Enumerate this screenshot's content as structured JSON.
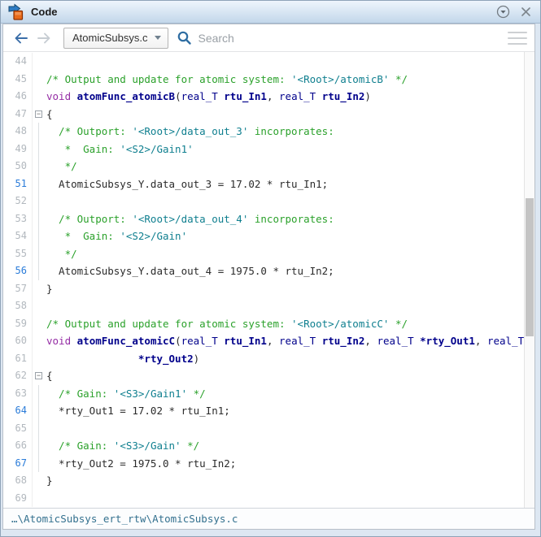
{
  "window": {
    "title": "Code"
  },
  "toolbar": {
    "back_label": "back",
    "forward_label": "forward",
    "file_selector": "AtomicSubsys.c",
    "search_placeholder": "Search"
  },
  "statusbar": {
    "path": "…\\AtomicSubsys_ert_rtw\\AtomicSubsys.c"
  },
  "colors": {
    "comment_green": "#2ba12b",
    "model_link_teal": "#0f7f8f",
    "keyword_purple": "#952da5",
    "identifier_navy": "#00008b",
    "traced_line_number_blue": "#2b7cd9",
    "plain_code": "#2b2b2b",
    "titlebar_gradient_top": "#eef5fc",
    "titlebar_gradient_bottom": "#c3d7ea"
  },
  "editor": {
    "lines": [
      {
        "n": 44,
        "segs": []
      },
      {
        "n": 45,
        "segs": [
          [
            "c",
            "/* Output and update for atomic system: "
          ],
          [
            "l",
            "'<Root>/atomicB'"
          ],
          [
            "c",
            " */"
          ]
        ]
      },
      {
        "n": 46,
        "segs": [
          [
            "k",
            "void "
          ],
          [
            "f",
            "atomFunc_atomicB"
          ],
          [
            "p",
            "("
          ],
          [
            "t",
            "real_T "
          ],
          [
            "v",
            "rtu_In1"
          ],
          [
            "p",
            ", "
          ],
          [
            "t",
            "real_T "
          ],
          [
            "v",
            "rtu_In2"
          ],
          [
            "p",
            ")"
          ]
        ]
      },
      {
        "n": 47,
        "segs": [
          [
            "p",
            "{"
          ]
        ],
        "fold": true
      },
      {
        "n": 48,
        "segs": [
          [
            "c",
            "  /* Outport: "
          ],
          [
            "l",
            "'<Root>/data_out_3'"
          ],
          [
            "c",
            " incorporates:"
          ]
        ],
        "guide": true
      },
      {
        "n": 49,
        "segs": [
          [
            "c",
            "   *  Gain: "
          ],
          [
            "l",
            "'<S2>/Gain1'"
          ]
        ],
        "guide": true
      },
      {
        "n": 50,
        "segs": [
          [
            "c",
            "   */"
          ]
        ],
        "guide": true
      },
      {
        "n": 51,
        "segs": [
          [
            "p",
            "  AtomicSubsys_Y.data_out_3 = 17.02 * rtu_In1;"
          ]
        ],
        "blue": true,
        "guide": true
      },
      {
        "n": 52,
        "segs": [],
        "guide": true
      },
      {
        "n": 53,
        "segs": [
          [
            "c",
            "  /* Outport: "
          ],
          [
            "l",
            "'<Root>/data_out_4'"
          ],
          [
            "c",
            " incorporates:"
          ]
        ],
        "guide": true
      },
      {
        "n": 54,
        "segs": [
          [
            "c",
            "   *  Gain: "
          ],
          [
            "l",
            "'<S2>/Gain'"
          ]
        ],
        "guide": true
      },
      {
        "n": 55,
        "segs": [
          [
            "c",
            "   */"
          ]
        ],
        "guide": true
      },
      {
        "n": 56,
        "segs": [
          [
            "p",
            "  AtomicSubsys_Y.data_out_4 = 1975.0 * rtu_In2;"
          ]
        ],
        "blue": true,
        "guide": true
      },
      {
        "n": 57,
        "segs": [
          [
            "p",
            "}"
          ]
        ]
      },
      {
        "n": 58,
        "segs": []
      },
      {
        "n": 59,
        "segs": [
          [
            "c",
            "/* Output and update for atomic system: "
          ],
          [
            "l",
            "'<Root>/atomicC'"
          ],
          [
            "c",
            " */"
          ]
        ]
      },
      {
        "n": 60,
        "segs": [
          [
            "k",
            "void "
          ],
          [
            "f",
            "atomFunc_atomicC"
          ],
          [
            "p",
            "("
          ],
          [
            "t",
            "real_T "
          ],
          [
            "v",
            "rtu_In1"
          ],
          [
            "p",
            ", "
          ],
          [
            "t",
            "real_T "
          ],
          [
            "v",
            "rtu_In2"
          ],
          [
            "p",
            ", "
          ],
          [
            "t",
            "real_T "
          ],
          [
            "v",
            "*rty_Out1"
          ],
          [
            "p",
            ", "
          ],
          [
            "t",
            "real_T"
          ]
        ]
      },
      {
        "n": 61,
        "segs": [
          [
            "p",
            "               "
          ],
          [
            "v",
            "*rty_Out2"
          ],
          [
            "p",
            ")"
          ]
        ]
      },
      {
        "n": 62,
        "segs": [
          [
            "p",
            "{"
          ]
        ],
        "fold": true
      },
      {
        "n": 63,
        "segs": [
          [
            "c",
            "  /* Gain: "
          ],
          [
            "l",
            "'<S3>/Gain1'"
          ],
          [
            "c",
            " */"
          ]
        ],
        "guide": true
      },
      {
        "n": 64,
        "segs": [
          [
            "p",
            "  *rty_Out1 = 17.02 * rtu_In1;"
          ]
        ],
        "blue": true,
        "guide": true
      },
      {
        "n": 65,
        "segs": [],
        "guide": true
      },
      {
        "n": 66,
        "segs": [
          [
            "c",
            "  /* Gain: "
          ],
          [
            "l",
            "'<S3>/Gain'"
          ],
          [
            "c",
            " */"
          ]
        ],
        "guide": true
      },
      {
        "n": 67,
        "segs": [
          [
            "p",
            "  *rty_Out2 = 1975.0 * rtu_In2;"
          ]
        ],
        "blue": true,
        "guide": true
      },
      {
        "n": 68,
        "segs": [
          [
            "p",
            "}"
          ]
        ]
      },
      {
        "n": 69,
        "segs": []
      }
    ]
  }
}
